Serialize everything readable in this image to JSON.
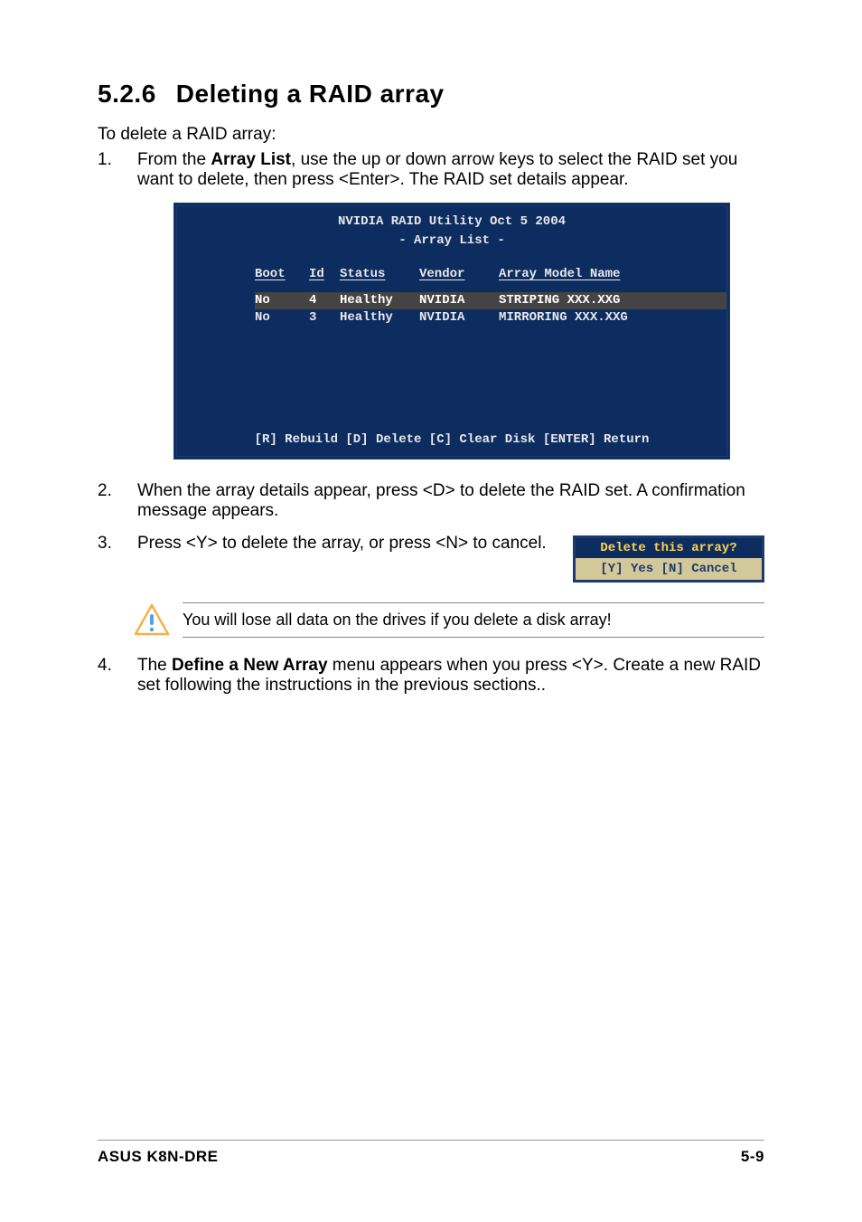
{
  "section": {
    "number": "5.2.6",
    "title": "Deleting a RAID array"
  },
  "intro": "To delete a RAID array:",
  "step1": {
    "num": "1.",
    "prefix": "From the ",
    "bold": "Array List",
    "suffix": ", use the up or down arrow keys to select the RAID set you want to delete, then press <Enter>. The RAID set details appear."
  },
  "terminal": {
    "title": "NVIDIA RAID Utility  Oct 5 2004",
    "subtitle": "- Array List -",
    "headers": {
      "boot": "Boot",
      "id": "Id",
      "status": "Status",
      "vendor": "Vendor",
      "model": "Array Model Name"
    },
    "rows": [
      {
        "boot": "No",
        "id": "4",
        "status": "Healthy",
        "vendor": "NVIDIA",
        "model": "STRIPING  XXX.XXG"
      },
      {
        "boot": "No",
        "id": "3",
        "status": "Healthy",
        "vendor": "NVIDIA",
        "model": "MIRRORING XXX.XXG"
      }
    ],
    "footer": "[R] Rebuild  [D] Delete  [C] Clear Disk  [ENTER] Return"
  },
  "step2": {
    "num": "2.",
    "text": "When the array details appear, press <D> to delete the RAID set. A confirmation message appears."
  },
  "step3": {
    "num": "3.",
    "text": "Press <Y> to delete the array, or press <N> to cancel."
  },
  "confirm": {
    "head": "Delete this array?",
    "body": "[Y] Yes   [N] Cancel"
  },
  "note": "You will lose all data on the drives if you delete a disk array!",
  "step4": {
    "num": "4.",
    "prefix": "The ",
    "bold": "Define a New Array",
    "suffix": " menu appears when you press <Y>. Create a new RAID set following the instructions in the previous sections.."
  },
  "footer": {
    "left": "ASUS K8N-DRE",
    "right": "5-9"
  }
}
